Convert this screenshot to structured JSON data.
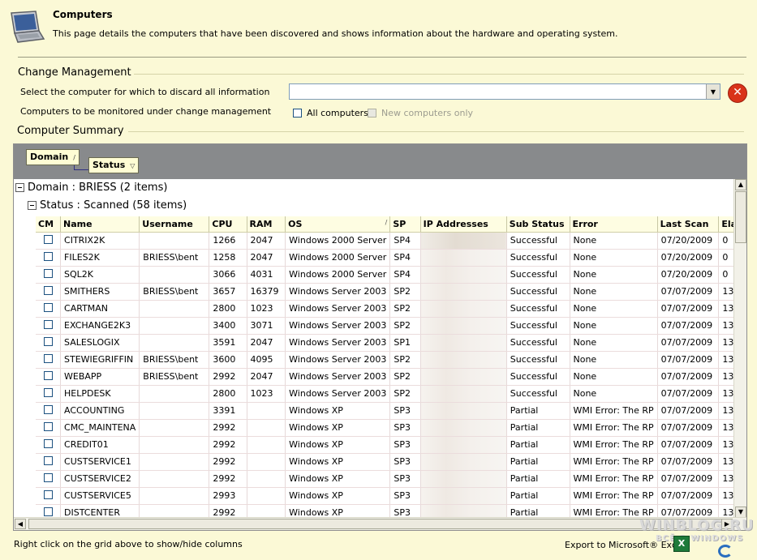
{
  "header": {
    "title": "Computers",
    "description": "This page details the computers that have been discovered and shows information about the hardware and operating system."
  },
  "change_management": {
    "title": "Change Management",
    "discard_label": "Select the computer for which to discard all information",
    "discard_value": "",
    "monitor_label": "Computers to be monitored under change management",
    "all_computers_label": "All computers",
    "new_computers_label": "New computers only"
  },
  "summary": {
    "title": "Computer Summary",
    "group_by": [
      "Domain",
      "Status"
    ],
    "domain_group": "Domain : BRIESS (2 items)",
    "status_group": "Status : Scanned (58 items)",
    "columns": [
      "CM",
      "Name",
      "Username",
      "CPU",
      "RAM",
      "OS",
      "SP",
      "IP Addresses",
      "Sub Status",
      "Error",
      "Last Scan",
      "Elap"
    ],
    "rows": [
      [
        "",
        "CITRIX2K",
        "",
        "1266",
        "2047",
        "Windows 2000 Server",
        "SP4",
        "",
        "Successful",
        "None",
        "07/20/2009",
        "0"
      ],
      [
        "",
        "FILES2K",
        "BRIESS\\bent",
        "1258",
        "2047",
        "Windows 2000 Server",
        "SP4",
        "",
        "Successful",
        "None",
        "07/20/2009",
        "0"
      ],
      [
        "",
        "SQL2K",
        "",
        "3066",
        "4031",
        "Windows 2000 Server",
        "SP4",
        "",
        "Successful",
        "None",
        "07/20/2009",
        "0"
      ],
      [
        "",
        "SMITHERS",
        "BRIESS\\bent",
        "3657",
        "16379",
        "Windows Server 2003",
        "SP2",
        "",
        "Successful",
        "None",
        "07/07/2009",
        "13"
      ],
      [
        "",
        "CARTMAN",
        "",
        "2800",
        "1023",
        "Windows Server 2003",
        "SP2",
        "",
        "Successful",
        "None",
        "07/07/2009",
        "13"
      ],
      [
        "",
        "EXCHANGE2K3",
        "",
        "3400",
        "3071",
        "Windows Server 2003",
        "SP2",
        "",
        "Successful",
        "None",
        "07/07/2009",
        "13"
      ],
      [
        "",
        "SALESLOGIX",
        "",
        "3591",
        "2047",
        "Windows Server 2003",
        "SP1",
        "",
        "Successful",
        "None",
        "07/07/2009",
        "13"
      ],
      [
        "",
        "STEWIEGRIFFIN",
        "BRIESS\\bent",
        "3600",
        "4095",
        "Windows Server 2003",
        "SP2",
        "",
        "Successful",
        "None",
        "07/07/2009",
        "13"
      ],
      [
        "",
        "WEBAPP",
        "BRIESS\\bent",
        "2992",
        "2047",
        "Windows Server 2003",
        "SP2",
        "",
        "Successful",
        "None",
        "07/07/2009",
        "13"
      ],
      [
        "",
        "HELPDESK",
        "",
        "2800",
        "1023",
        "Windows Server 2003",
        "SP2",
        "",
        "Successful",
        "None",
        "07/07/2009",
        "13"
      ],
      [
        "",
        "ACCOUNTING",
        "",
        "3391",
        "",
        "Windows XP",
        "SP3",
        "",
        "Partial",
        "WMI Error: The RP",
        "07/07/2009",
        "13"
      ],
      [
        "",
        "CMC_MAINTENA",
        "",
        "2992",
        "",
        "Windows XP",
        "SP3",
        "",
        "Partial",
        "WMI Error: The RP",
        "07/07/2009",
        "13"
      ],
      [
        "",
        "CREDIT01",
        "",
        "2992",
        "",
        "Windows XP",
        "SP3",
        "",
        "Partial",
        "WMI Error: The RP",
        "07/07/2009",
        "13"
      ],
      [
        "",
        "CUSTSERVICE1",
        "",
        "2992",
        "",
        "Windows XP",
        "SP3",
        "",
        "Partial",
        "WMI Error: The RP",
        "07/07/2009",
        "13"
      ],
      [
        "",
        "CUSTSERVICE2",
        "",
        "2992",
        "",
        "Windows XP",
        "SP3",
        "",
        "Partial",
        "WMI Error: The RP",
        "07/07/2009",
        "13"
      ],
      [
        "",
        "CUSTSERVICE5",
        "",
        "2993",
        "",
        "Windows XP",
        "SP3",
        "",
        "Partial",
        "WMI Error: The RP",
        "07/07/2009",
        "13"
      ],
      [
        "",
        "DISTCENTER",
        "",
        "2992",
        "",
        "Windows XP",
        "SP3",
        "",
        "Partial",
        "WMI Error: The RP",
        "07/07/2009",
        "13"
      ]
    ]
  },
  "footer": {
    "hint": "Right click on the grid above to show/hide columns",
    "export_label": "Export to Microsoft® Excel",
    "watermark": "WINBLOG.RU",
    "watermark_sub": "ВСЁ О WINDOWS"
  },
  "colors": {
    "background": "#fbf9d6",
    "group_panel": "#888a8c",
    "discard": "#d9331a"
  },
  "icons": [
    "laptop-icon",
    "dropdown-arrow-icon",
    "discard-icon",
    "sort-icon",
    "filter-icon",
    "collapse-icon",
    "excel-icon",
    "refresh-icon"
  ]
}
